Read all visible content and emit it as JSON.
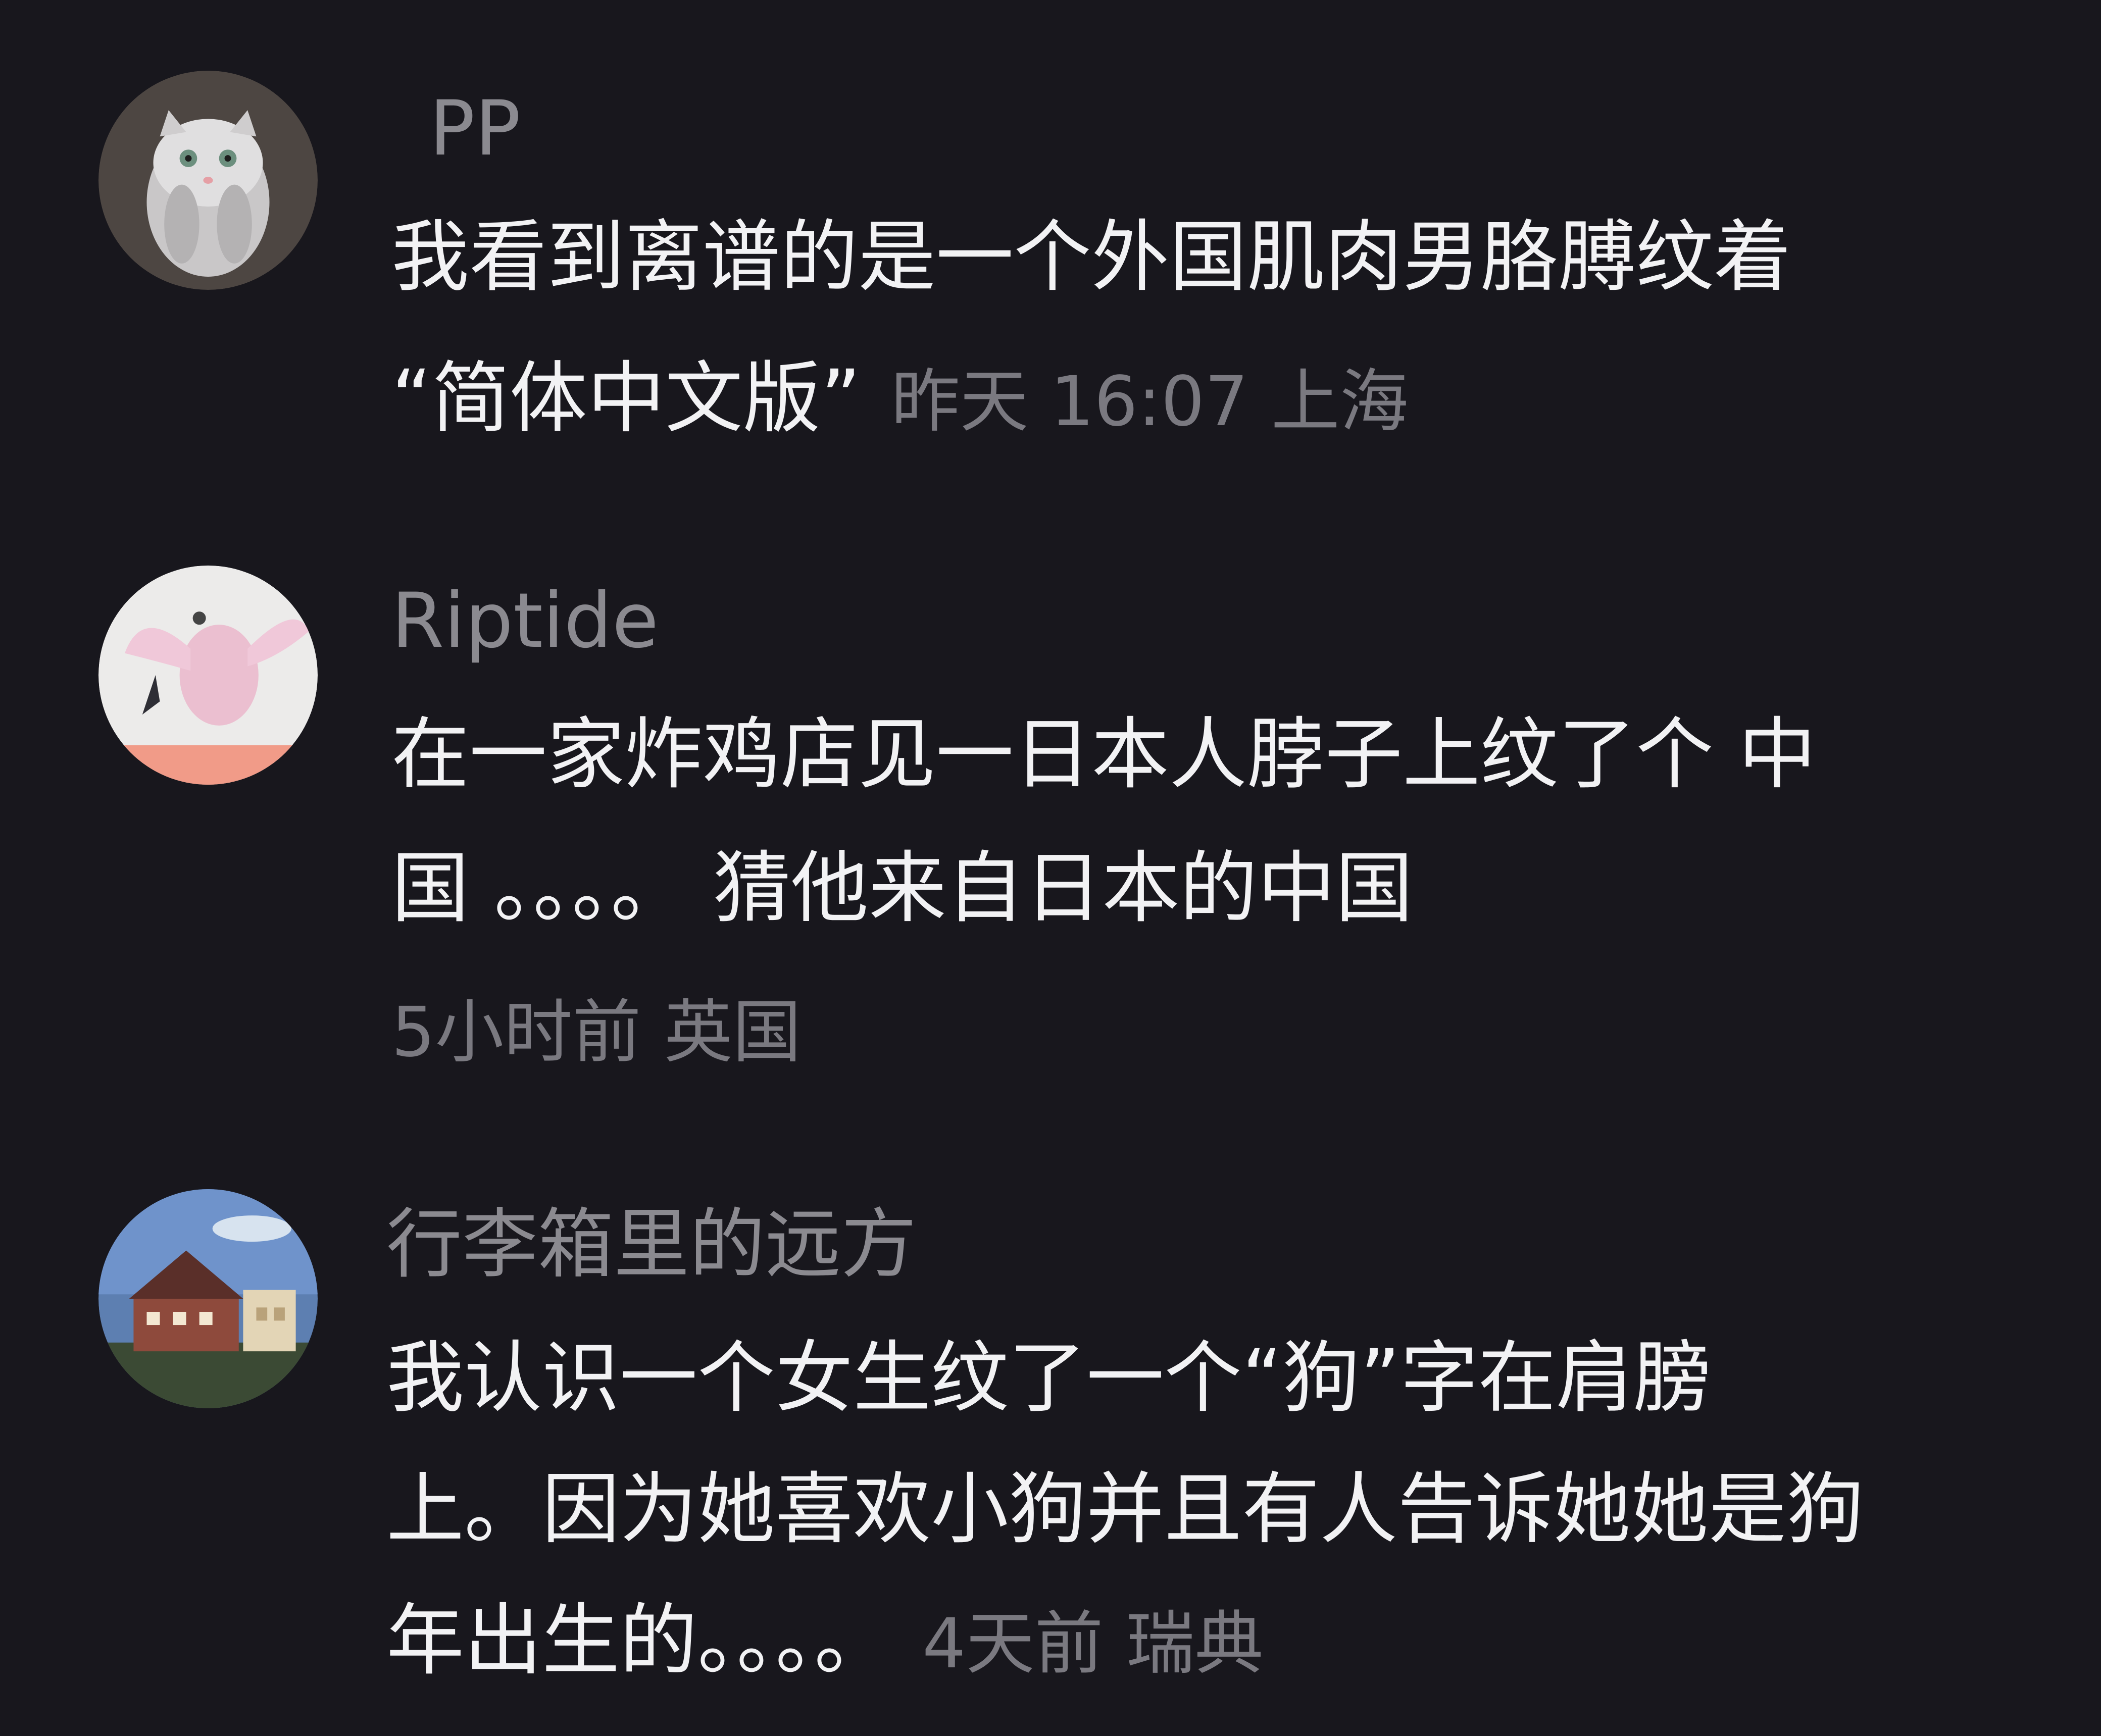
{
  "comments": [
    {
      "username": "PP",
      "avatar_icon": "cat-avatar",
      "lines": [
        "我看到离谱的是一个外国肌肉男胳膊纹着",
        "“简体中文版”"
      ],
      "time": "昨天 16:07",
      "location": "上海"
    },
    {
      "username": "Riptide",
      "avatar_icon": "pink-bird-avatar",
      "lines": [
        "在一家炸鸡店见一日本人脖子上纹了个 中",
        "国 。。。。 猜他来自日本的中国"
      ],
      "time": "5小时前",
      "location": "英国"
    },
    {
      "username": "行李箱里的远方",
      "avatar_icon": "house-avatar",
      "lines": [
        "我认识一个女生纹了一个“狗”字在肩膀",
        "上。因为她喜欢小狗并且有人告诉她她是狗",
        "年出生的。。。。"
      ],
      "time": "4天前",
      "location": "瑞典"
    }
  ],
  "colors": {
    "background": "#18171d",
    "text": "#f2f2f4",
    "username": "#8b8a90",
    "meta": "#7a7980"
  }
}
